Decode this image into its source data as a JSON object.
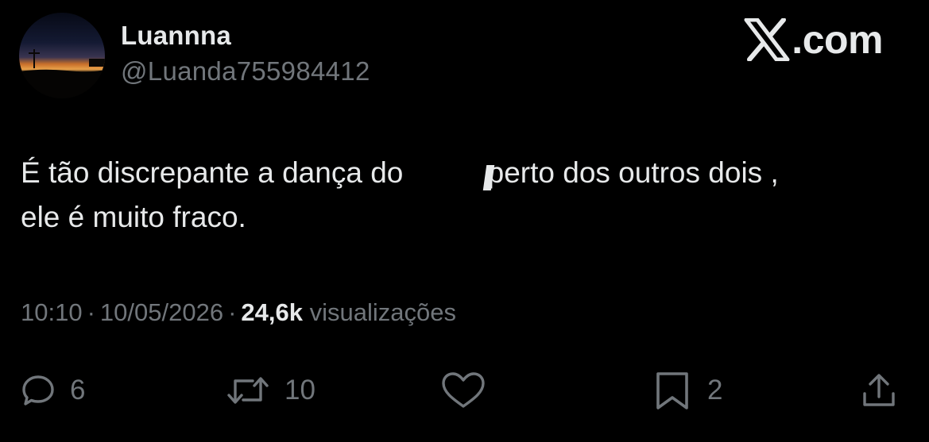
{
  "author": {
    "name": "Luannna",
    "handle": "@Luanda755984412"
  },
  "brand": {
    "domain": ".com"
  },
  "tweet": {
    "line1_before": "É tão discrepante a dança do ",
    "line1_after": "perto dos outros dois ,",
    "line2": "ele é muito fraco."
  },
  "meta": {
    "time": "10:10",
    "date": "10/05/2026",
    "views_count": "24,6k",
    "views_label": "visualizações"
  },
  "actions": {
    "replies": "6",
    "retweets": "10",
    "bookmarks": "2"
  },
  "icons": {
    "reply": "speech-bubble-icon",
    "retweet": "retweet-arrows-icon",
    "like": "heart-icon",
    "bookmark": "bookmark-icon",
    "share": "share-upload-icon",
    "brand": "x-logo-icon"
  },
  "colors": {
    "background": "#000000",
    "primary_text": "#e7e9ea",
    "secondary_text": "#71767b"
  }
}
